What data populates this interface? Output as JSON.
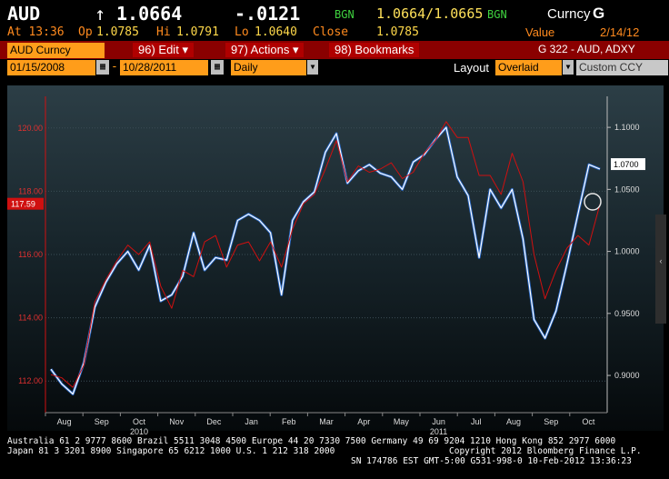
{
  "header": {
    "ticker": "AUD",
    "arrow": "↑",
    "price": "1.0664",
    "change": "-.0121",
    "source1": "BGN",
    "bid_ask": "1.0664/1.0665",
    "source2": "BGN",
    "security_type": "Curncy",
    "function_key": "G"
  },
  "quote_line": {
    "time": "At 13:36",
    "open_label": "Op",
    "open": "1.0785",
    "high_label": "Hi",
    "high": "1.0791",
    "low_label": "Lo",
    "low": "1.0640",
    "close_label": "Close",
    "close": "1.0785",
    "value_label": "Value",
    "value_date": "2/14/12"
  },
  "toolbar": {
    "security_field": "AUD Curncy",
    "edit_menu": "96) Edit",
    "actions_menu": "97) Actions",
    "bookmarks_menu": "98) Bookmarks",
    "chart_id": "G 322 - AUD, ADXY"
  },
  "controls": {
    "start_date": "01/15/2008",
    "end_date": "10/28/2011",
    "period": "Daily",
    "layout_label": "Layout",
    "layout_value": "Overlaid",
    "custom_label": "Custom CCY"
  },
  "chart_data": {
    "type": "line",
    "series": [
      {
        "name": "",
        "axis": "right",
        "color": "#ffffff",
        "values": [
          0.905,
          0.893,
          0.885,
          0.91,
          0.955,
          0.975,
          0.99,
          1.0,
          0.985,
          1.005,
          0.96,
          0.965,
          0.98,
          1.015,
          0.985,
          0.995,
          0.993,
          1.025,
          1.03,
          1.025,
          1.015,
          0.965,
          1.025,
          1.04,
          1.048,
          1.08,
          1.095,
          1.055,
          1.065,
          1.07,
          1.063,
          1.06,
          1.05,
          1.072,
          1.078,
          1.09,
          1.1,
          1.06,
          1.045,
          0.995,
          1.05,
          1.035,
          1.05,
          1.01,
          0.945,
          0.93,
          0.952,
          0.99,
          1.03,
          1.07,
          1.0664
        ]
      },
      {
        "name": "",
        "axis": "left",
        "color": "#d01010",
        "values": [
          112.2,
          112.1,
          111.8,
          112.5,
          114.5,
          115.2,
          115.8,
          116.3,
          116.0,
          116.4,
          115.0,
          114.3,
          115.5,
          115.3,
          116.4,
          116.6,
          115.6,
          116.3,
          116.4,
          115.8,
          116.4,
          115.6,
          116.8,
          117.6,
          117.9,
          118.7,
          119.6,
          118.3,
          118.8,
          118.6,
          118.7,
          118.9,
          118.4,
          118.6,
          119.2,
          119.6,
          120.2,
          119.7,
          119.7,
          118.5,
          118.5,
          117.9,
          119.2,
          118.3,
          116.0,
          114.6,
          115.5,
          116.2,
          116.6,
          116.3,
          117.59
        ]
      }
    ],
    "x_labels": [
      "Aug",
      "Sep",
      "Oct",
      "Nov",
      "Dec",
      "Jan",
      "Feb",
      "Mar",
      "Apr",
      "May",
      "Jun",
      "Jul",
      "Aug",
      "Sep",
      "Oct"
    ],
    "year_labels": [
      "2010",
      "2011"
    ],
    "left_axis": {
      "ticks": [
        "112.00",
        "114.00",
        "116.00",
        "118.00",
        "120.00"
      ],
      "range": [
        111.0,
        121.0
      ],
      "tag": "117.59"
    },
    "right_axis": {
      "ticks": [
        "0.9000",
        "0.9500",
        "1.0000",
        "1.0500",
        "1.1000"
      ],
      "range": [
        0.87,
        1.125
      ],
      "tag": "1.0700"
    },
    "grid": true
  },
  "footer": {
    "line1": "Australia 61 2 9777 8600 Brazil 5511 3048 4500 Europe 44 20 7330 7500 Germany 49 69 9204 1210 Hong Kong 852 2977 6000",
    "line2a": "Japan 81 3 3201 8900       Singapore 65 6212 1000       U.S. 1 212 318 2000",
    "line2b": "Copyright 2012 Bloomberg Finance L.P.",
    "line3": "SN 174786 EST  GMT-5:00 G531-998-0 10-Feb-2012 13:36:23"
  },
  "colors": {
    "accent_orange": "#ff9d1a",
    "menu_red": "#b00000",
    "chart_bg": "#14232a",
    "green": "#3fd33f",
    "yellow": "#ffe15a"
  }
}
